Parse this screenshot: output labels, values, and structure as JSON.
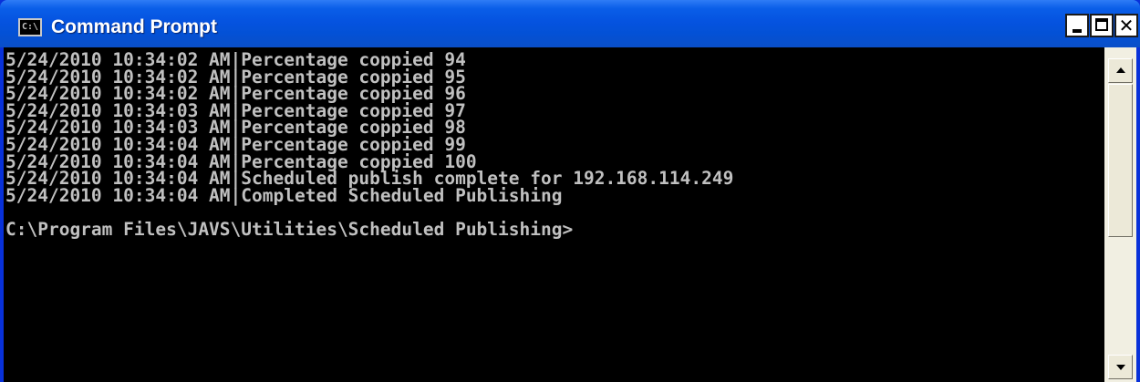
{
  "window": {
    "title": "Command Prompt",
    "icon": "command-prompt-icon",
    "icon_text": "C:\\",
    "controls": {
      "minimize_icon": "minimize-icon",
      "maximize_icon": "maximize-icon",
      "close_icon": "close-icon",
      "close_glyph": "✕"
    }
  },
  "console": {
    "lines": [
      "5/24/2010 10:34:02 AM|Percentage coppied 94",
      "5/24/2010 10:34:02 AM|Percentage coppied 95",
      "5/24/2010 10:34:02 AM|Percentage coppied 96",
      "5/24/2010 10:34:03 AM|Percentage coppied 97",
      "5/24/2010 10:34:03 AM|Percentage coppied 98",
      "5/24/2010 10:34:04 AM|Percentage coppied 99",
      "5/24/2010 10:34:04 AM|Percentage coppied 100",
      "5/24/2010 10:34:04 AM|Scheduled publish complete for 192.168.114.249",
      "5/24/2010 10:34:04 AM|Completed Scheduled Publishing",
      "",
      "C:\\Program Files\\JAVS\\Utilities\\Scheduled Publishing>"
    ]
  },
  "colors": {
    "title_bar": "#0553e0",
    "console_bg": "#000000",
    "console_text": "#c0c0c0"
  }
}
